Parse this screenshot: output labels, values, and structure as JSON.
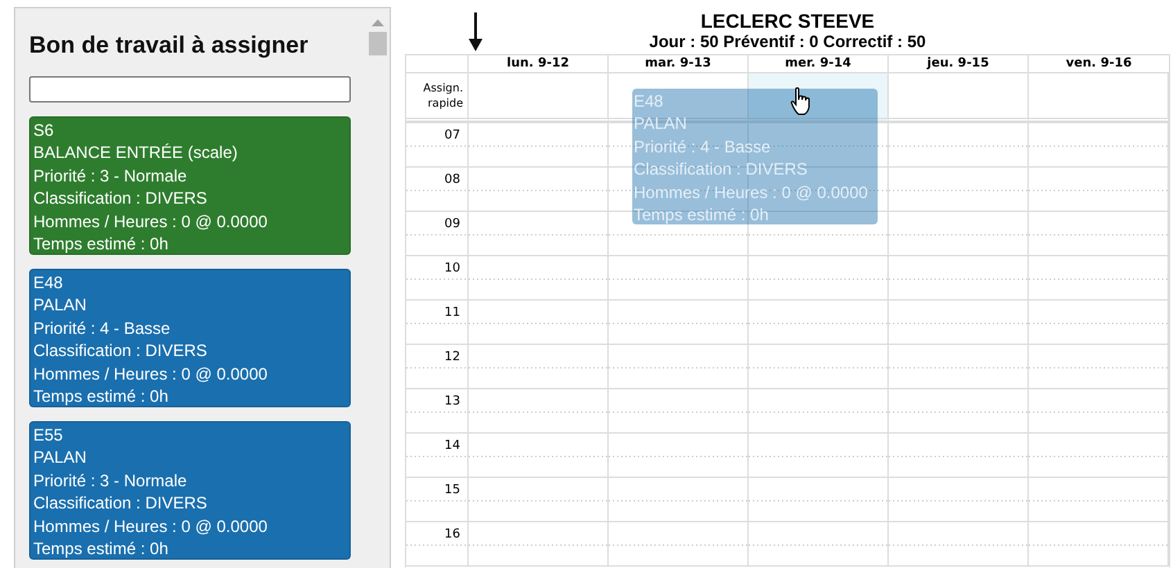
{
  "sidebar": {
    "title": "Bon de travail à assigner",
    "cards": [
      {
        "lines": [
          "S6",
          "BALANCE ENTRÉE (scale)",
          "Priorité : 3 - Normale",
          "Classification : DIVERS",
          "Hommes / Heures : 0 @ 0.0000",
          "Temps estimé : 0h"
        ],
        "color": "#2e7d2e"
      },
      {
        "lines": [
          "E48",
          "PALAN",
          "Priorité : 4 - Basse",
          "Classification : DIVERS",
          "Hommes / Heures : 0 @ 0.0000",
          "Temps estimé : 0h"
        ],
        "color": "#1a6fae"
      },
      {
        "lines": [
          "E55",
          "PALAN",
          "Priorité : 3 - Normale",
          "Classification : DIVERS",
          "Hommes / Heures : 0 @ 0.0000",
          "Temps estimé : 0h"
        ],
        "color": "#1a6fae"
      }
    ]
  },
  "calendar": {
    "title": "LECLERC STEEVE",
    "summary": "Jour : 50 Préventif : 0 Correctif : 50",
    "quick_assign": "Assign. rapide",
    "days": [
      {
        "label": "lun. 9-12",
        "drop_target": false
      },
      {
        "label": "mar. 9-13",
        "drop_target": false
      },
      {
        "label": "mer. 9-14",
        "drop_target": true
      },
      {
        "label": "jeu. 9-15",
        "drop_target": false
      },
      {
        "label": "ven. 9-16",
        "drop_target": false
      }
    ],
    "hours": [
      "07",
      "08",
      "09",
      "10",
      "11",
      "12",
      "13",
      "14",
      "15",
      "16"
    ],
    "dragged_card": {
      "lines": [
        "E48",
        "PALAN",
        "Priorité : 4 - Basse",
        "Classification : DIVERS",
        "Hommes / Heures : 0 @ 0.0000",
        "Temps estimé : 0h"
      ]
    }
  }
}
